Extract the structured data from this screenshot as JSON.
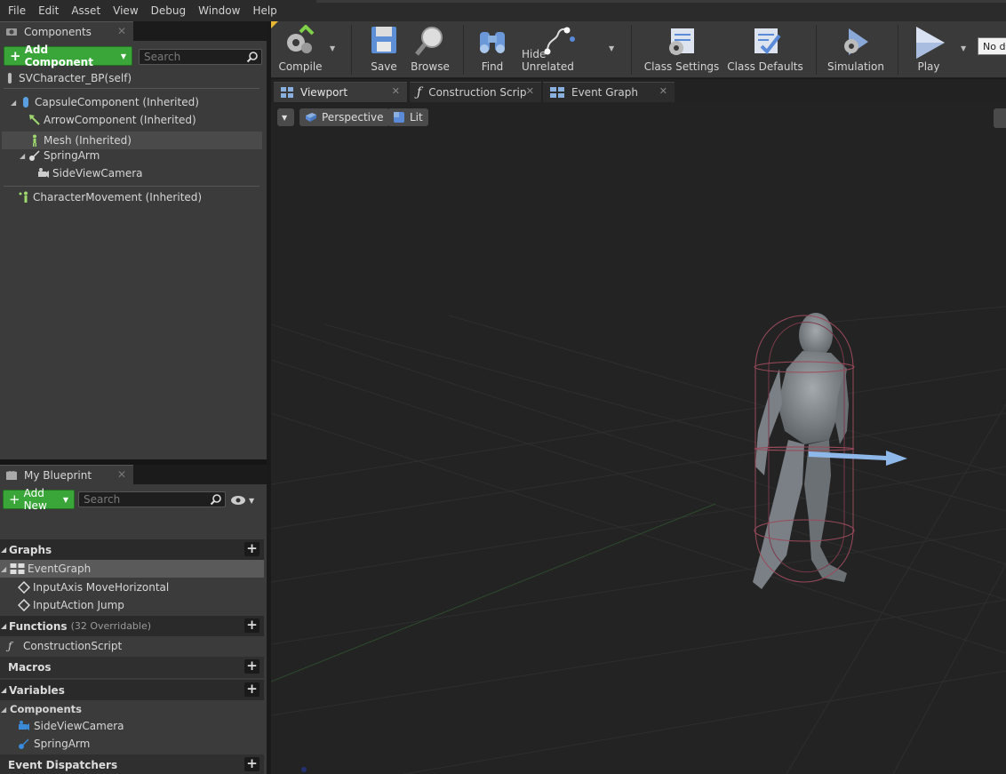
{
  "menu": [
    "File",
    "Edit",
    "Asset",
    "View",
    "Debug",
    "Window",
    "Help"
  ],
  "components_panel": {
    "tab_label": "Components",
    "add_button": "Add Component",
    "search_placeholder": "Search",
    "root": "SVCharacter_BP(self)",
    "items": [
      "CapsuleComponent (Inherited)",
      "ArrowComponent (Inherited)",
      "Mesh (Inherited)",
      "SpringArm",
      "SideViewCamera",
      "CharacterMovement (Inherited)"
    ]
  },
  "blueprint_panel": {
    "tab_label": "My Blueprint",
    "add_button": "Add New",
    "search_placeholder": "Search",
    "graphs_label": "Graphs",
    "graph_items": [
      "EventGraph",
      "InputAxis MoveHorizontal",
      "InputAction Jump"
    ],
    "functions_label": "Functions",
    "functions_sub": "(32 Overridable)",
    "function_items": [
      "ConstructionScript"
    ],
    "macros_label": "Macros",
    "variables_label": "Variables",
    "components_label": "Components",
    "component_vars": [
      "SideViewCamera",
      "SpringArm"
    ],
    "dispatchers_label": "Event Dispatchers"
  },
  "toolbar": {
    "compile": "Compile",
    "save": "Save",
    "browse": "Browse",
    "find": "Find",
    "hide_unrelated": "Hide Unrelated",
    "class_settings": "Class Settings",
    "class_defaults": "Class Defaults",
    "simulation": "Simulation",
    "play": "Play",
    "debug_filter": "No debug object selected"
  },
  "doc_tabs": [
    "Viewport",
    "Construction Scrip",
    "Event Graph"
  ],
  "viewport": {
    "perspective": "Perspective",
    "lit": "Lit"
  },
  "colors": {
    "accent_green": "#3aa63a",
    "panel_bg": "#3b3b3b",
    "viewport_bg": "#232323"
  }
}
